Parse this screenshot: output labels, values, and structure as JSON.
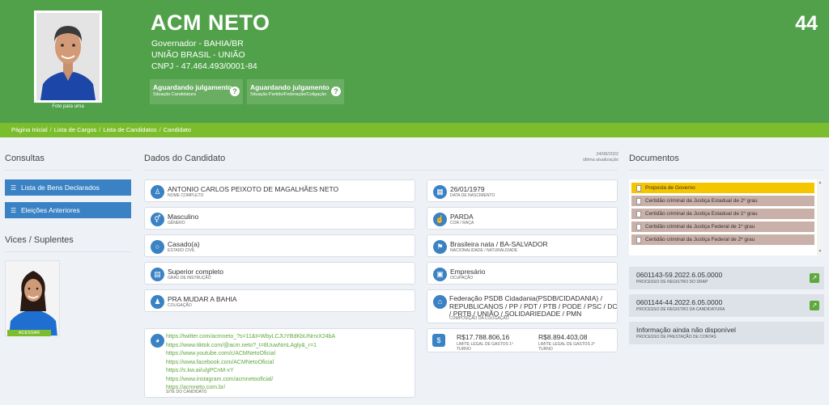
{
  "header": {
    "photo_caption": "Foto para urna",
    "name": "ACM NETO",
    "number": "44",
    "role": "Governador - BAHIA/BR",
    "party": "UNIÃO BRASIL - UNIÃO",
    "cnpj": "CNPJ - 47.464.493/0001-84",
    "status": [
      {
        "title": "Aguardando julgamento",
        "subtitle": "Situação Candidatura"
      },
      {
        "title": "Aguardando julgamento",
        "subtitle": "Situação Partido/Federação/Coligação"
      }
    ],
    "status_icon": "?"
  },
  "breadcrumb": [
    "Página Inicial",
    "Lista de Cargos",
    "Lista de Candidatos",
    "Candidato"
  ],
  "breadcrumb_sep": "/",
  "left": {
    "consultas_title": "Consultas",
    "buttons": [
      "Lista de Bens Declarados",
      "Eleições Anteriores"
    ],
    "vices_title": "Vices / Suplentes",
    "vice_button": "ACESSAR"
  },
  "middle": {
    "title": "Dados do Candidato",
    "updated_date": "24/08/2022",
    "updated_label": "última atualização",
    "fields": [
      {
        "value": "ANTONIO CARLOS PEIXOTO DE MAGALHÃES NETO",
        "label": "NOME COMPLETO",
        "icon": "user-icon"
      },
      {
        "value": "26/01/1979",
        "label": "DATA DE NASCIMENTO",
        "icon": "calendar-icon"
      },
      {
        "value": "Masculino",
        "label": "GÊNERO",
        "icon": "gender-icon"
      },
      {
        "value": "PARDA",
        "label": "COR / RAÇA",
        "icon": "hand-icon"
      },
      {
        "value": "Casado(a)",
        "label": "ESTADO CIVIL",
        "icon": "ring-icon"
      },
      {
        "value": "Brasileira nata / BA-SALVADOR",
        "label": "NACIONALIDADE / NATURALIDADE",
        "icon": "flag-icon"
      },
      {
        "value": "Superior completo",
        "label": "GRAU DE INSTRUÇÃO",
        "icon": "book-icon"
      },
      {
        "value": "Empresário",
        "label": "OCUPAÇÃO",
        "icon": "briefcase-icon"
      },
      {
        "value": "PRA MUDAR A BAHIA",
        "label": "COLIGAÇÃO",
        "icon": "group-icon"
      }
    ],
    "composition": {
      "value": "Federação PSDB Cidadania(PSDB/CIDADANIA) / REPUBLICANOS / PP / PDT / PTB / PODE / PSC / DC / PRTB / UNIÃO / SOLIDARIEDADE / PMN",
      "label": "COMPOSIÇÃO DA COLIGAÇÃO"
    },
    "sites": [
      "https://twitter.com/acmneto_?s=11&t=WbyLCJUYBdKbUNrrxX24bA",
      "https://www.tiktok.com/@acm.neto?_t=8UuwNmLAgly&_r=1",
      "https://www.youtube.com/c/ACMNetoOficial",
      "https://www.facebook.com/ACMNetoOficial",
      "https://s.kw.ai/u/gPCnM-xY",
      "https://www.instagram.com/acmnetooficial/",
      "https://acmneto.com.br/"
    ],
    "sites_label": "SITE DO CANDIDATO",
    "spending": [
      {
        "value": "R$17.788.806,16",
        "label1": "LIMITE LEGAL DE GASTOS 1º",
        "label2": "TURNO"
      },
      {
        "value": "R$8.894.403,08",
        "label1": "LIMITE LEGAL DE GASTOS 2º",
        "label2": "TURNO"
      }
    ],
    "spending_icon": "$"
  },
  "right": {
    "title": "Documentos",
    "documents": [
      "Proposta de Governo",
      "Certidão criminal da Justiça Estadual de 2º grau",
      "Certidão criminal da Justiça Estadual de 1º grau",
      "Certidão criminal da Justiça Federal de 1º grau",
      "Certidão criminal da Justiça Federal de 2º grau"
    ],
    "processes": [
      {
        "value": "0601143-59.2022.6.05.0000",
        "label": "PROCESSO DE REGISTRO DO DRAP",
        "link": true
      },
      {
        "value": "0601144-44.2022.6.05.0000",
        "label": "PROCESSO DE REGISTRO DA CANDIDATURA",
        "link": true
      },
      {
        "value": "Informação ainda não disponível",
        "label": "PROCESSO DE PRESTAÇÃO DE CONTAS",
        "link": false
      }
    ]
  },
  "colors": {
    "header_green": "#51a14b",
    "breadcrumb_green": "#7cbd2d",
    "button_blue": "#3a82c3",
    "doc_highlight": "#f5c500",
    "doc_normal": "#c9b0a8",
    "link_green": "#5ea83c"
  }
}
